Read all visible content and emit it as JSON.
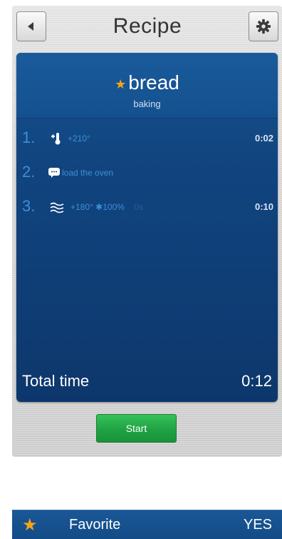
{
  "header": {
    "title": "Recipe",
    "back_icon": "back-arrow-icon",
    "settings_icon": "gear-icon"
  },
  "recipe": {
    "name": "bread",
    "category": "baking",
    "favorite_marker": "★"
  },
  "steps": [
    {
      "number": "1.",
      "icon": "probe-thermometer-icon",
      "text": "+210°",
      "extra": "",
      "time": "0:02"
    },
    {
      "number": "2.",
      "icon": "message-icon",
      "text": "load the oven",
      "extra": "",
      "time": ""
    },
    {
      "number": "3.",
      "icon": "hot-air-icon",
      "text": "+180° ✱100%",
      "extra": "0s",
      "time": "0:10"
    }
  ],
  "total": {
    "label": "Total time",
    "value": "0:12"
  },
  "start_button": {
    "label": "Start"
  },
  "favorite": {
    "icon": "star-icon",
    "label": "Favorite",
    "value": "YES"
  },
  "colors": {
    "screen_blue": "#114580",
    "step_text_blue": "#3d8fd8",
    "start_green": "#1fa244",
    "star_orange": "#f4a417"
  }
}
